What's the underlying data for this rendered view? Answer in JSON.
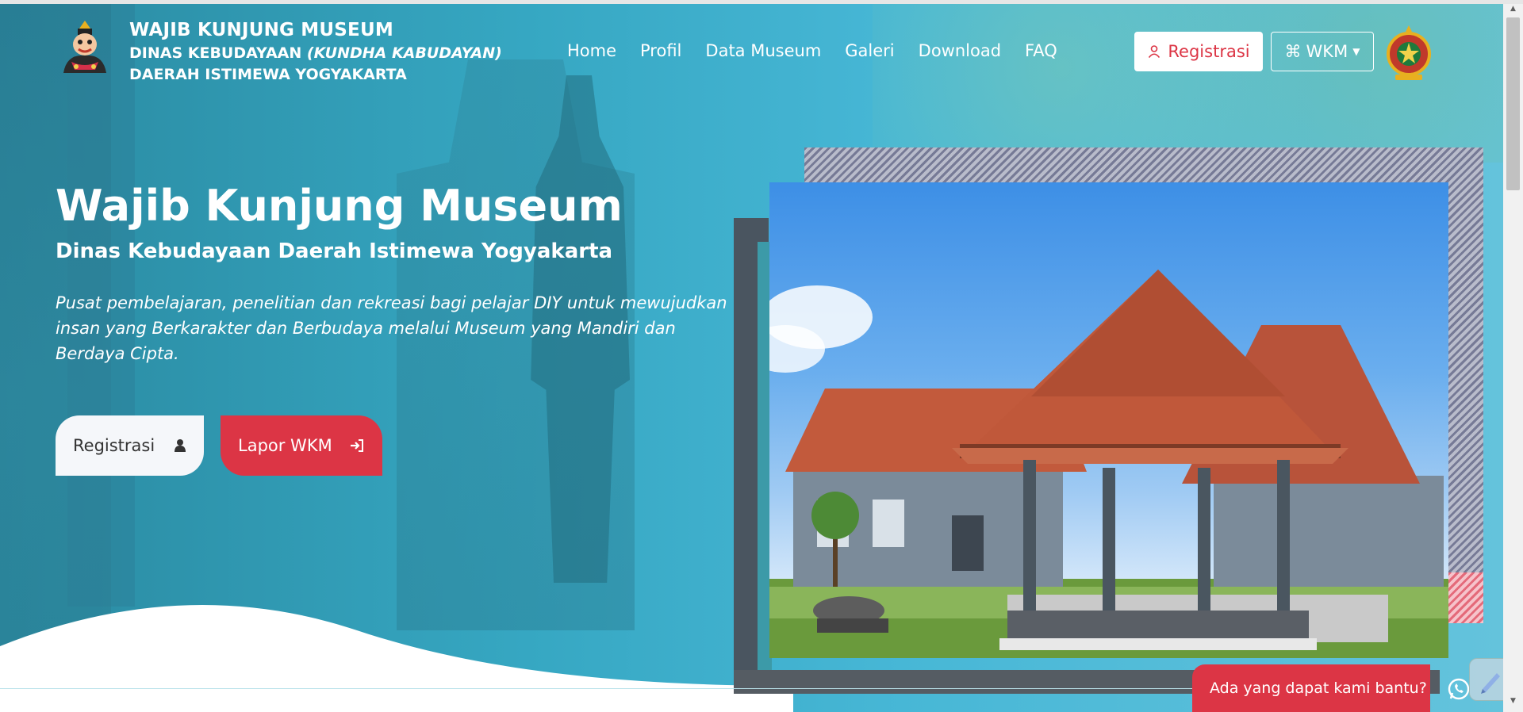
{
  "header": {
    "title": "WAJIB KUNJUNG MUSEUM",
    "subtitle_prefix": "DINAS KEBUDAYAAN",
    "subtitle_italic": "(KUNDHA KABUDAYAN)",
    "subtitle_line2": "DAERAH ISTIMEWA YOGYAKARTA"
  },
  "nav": {
    "items": [
      "Home",
      "Profil",
      "Data Museum",
      "Galeri",
      "Download",
      "FAQ"
    ]
  },
  "actions": {
    "register_label": "Registrasi",
    "wkm_label": "WKM",
    "wkm_icon": "command-icon"
  },
  "hero": {
    "title": "Wajib Kunjung Museum",
    "subtitle": "Dinas Kebudayaan Daerah Istimewa Yogyakarta",
    "description": "Pusat pembelajaran, penelitian dan rekreasi bagi pelajar DIY untuk mewujudkan insan yang Berkarakter dan Berbudaya melalui Museum yang Mandiri dan Berdaya Cipta.",
    "btn_register": "Registrasi",
    "btn_report": "Lapor WKM"
  },
  "help": {
    "label": "Ada yang dapat kami bantu?",
    "icon": "whatsapp-icon"
  },
  "colors": {
    "accent_red": "#dc3545",
    "hero_teal": "#36a7c2"
  }
}
